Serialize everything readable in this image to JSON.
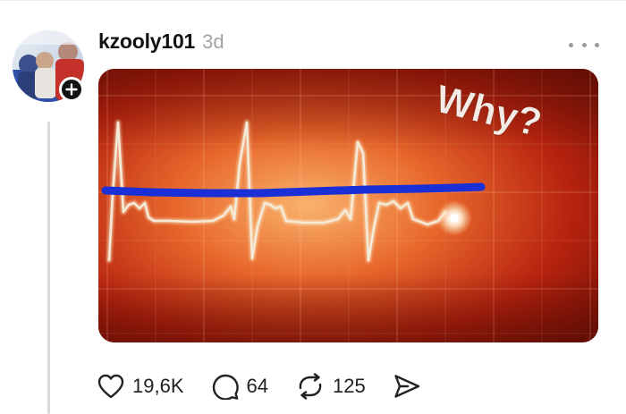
{
  "post": {
    "author": "kzooly101",
    "timestamp": "3d",
    "image_caption": "Why?"
  },
  "actions": {
    "likes": "19,6K",
    "replies": "64",
    "reposts": "125"
  },
  "colors": {
    "ecg_line": "#f4ead8",
    "annotation_line": "#1a2fd6",
    "monitor_background": "#b3200e",
    "text_muted": "#a3a3a3"
  },
  "icons": {
    "more": "more-horizontal-icon",
    "follow": "plus-icon",
    "like": "heart-icon",
    "reply": "speech-bubble-icon",
    "repost": "repost-icon",
    "share": "send-icon"
  }
}
